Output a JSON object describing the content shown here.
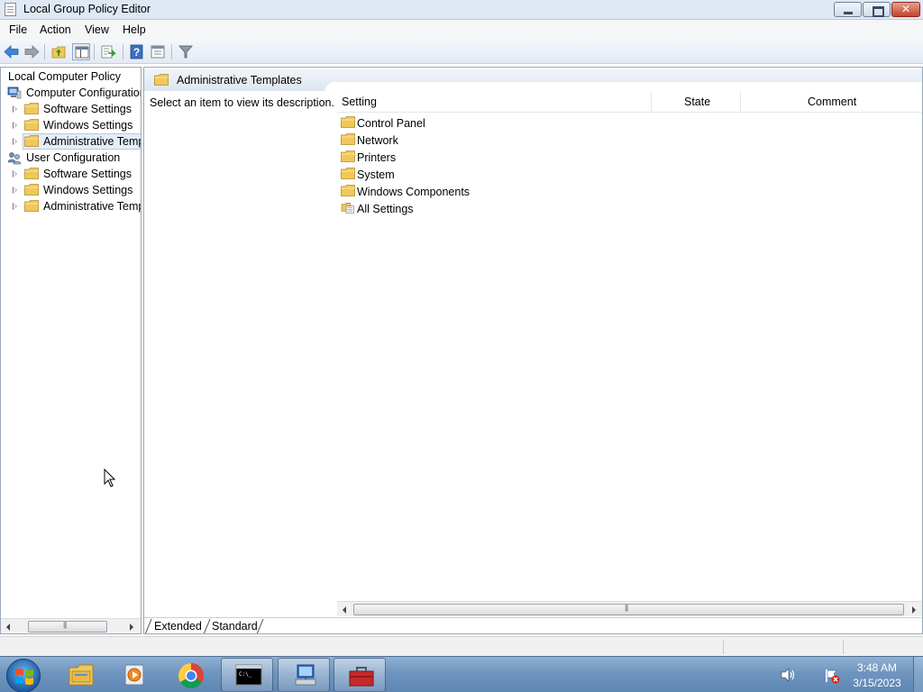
{
  "window": {
    "title": "Local Group Policy Editor"
  },
  "menu": [
    "File",
    "Action",
    "View",
    "Help"
  ],
  "toolbar": {
    "icons": [
      "back-icon",
      "forward-icon",
      "up-folder-icon",
      "show-hide-tree-icon",
      "export-list-icon",
      "help-icon",
      "properties-icon",
      "filter-icon"
    ]
  },
  "tree": {
    "root": "Local Computer Policy",
    "computer_config": "Computer Configuration",
    "computer_children": [
      "Software Settings",
      "Windows Settings",
      "Administrative Templates"
    ],
    "user_config": "User Configuration",
    "user_children": [
      "Software Settings",
      "Windows Settings",
      "Administrative Templates"
    ],
    "selected": "Administrative Templates"
  },
  "main": {
    "header_title": "Administrative Templates",
    "description": "Select an item to view its description.",
    "columns": [
      "Setting",
      "State",
      "Comment"
    ],
    "items": [
      {
        "label": "Control Panel",
        "icon": "folder-icon"
      },
      {
        "label": "Network",
        "icon": "folder-icon"
      },
      {
        "label": "Printers",
        "icon": "folder-icon"
      },
      {
        "label": "System",
        "icon": "folder-icon"
      },
      {
        "label": "Windows Components",
        "icon": "folder-icon"
      },
      {
        "label": "All Settings",
        "icon": "all-settings-icon"
      }
    ],
    "tabs": [
      "Extended",
      "Standard"
    ],
    "active_tab": "Extended"
  },
  "taskbar": {
    "apps": [
      "file-explorer-icon",
      "media-player-icon",
      "chrome-icon",
      "command-prompt-icon",
      "network-computer-icon",
      "toolbox-icon"
    ],
    "time": "3:48 AM",
    "date": "3/15/2023"
  },
  "colors": {
    "folder": "#f0c85a",
    "selection": "#e5eef8",
    "taskbar": "#6f95bf"
  }
}
